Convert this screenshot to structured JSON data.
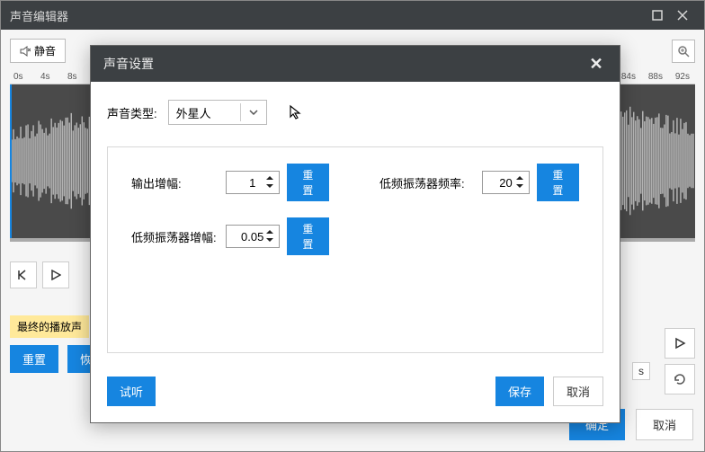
{
  "window": {
    "title": "声音编辑器"
  },
  "toolbar": {
    "mute": "静音"
  },
  "ruler": {
    "marks": [
      "0s",
      "4s",
      "8s",
      "84s",
      "88s",
      "92s"
    ]
  },
  "transport": {
    "speed_suffix": "s"
  },
  "status": {
    "label": "最终的播放声"
  },
  "actions": {
    "reset": "重置",
    "restore": "恢复到原始声音",
    "settings": "声音设置",
    "ok": "确定",
    "cancel": "取消"
  },
  "modal": {
    "title": "声音设置",
    "type_label": "声音类型:",
    "type_value": "外星人",
    "params": {
      "output_gain": {
        "label": "输出增幅:",
        "value": "1"
      },
      "lfo_gain": {
        "label": "低频振荡器增幅:",
        "value": "0.05"
      },
      "lfo_freq": {
        "label": "低频振荡器频率:",
        "value": "20"
      }
    },
    "reset": "重置",
    "preview": "试听",
    "save": "保存",
    "cancel": "取消"
  }
}
